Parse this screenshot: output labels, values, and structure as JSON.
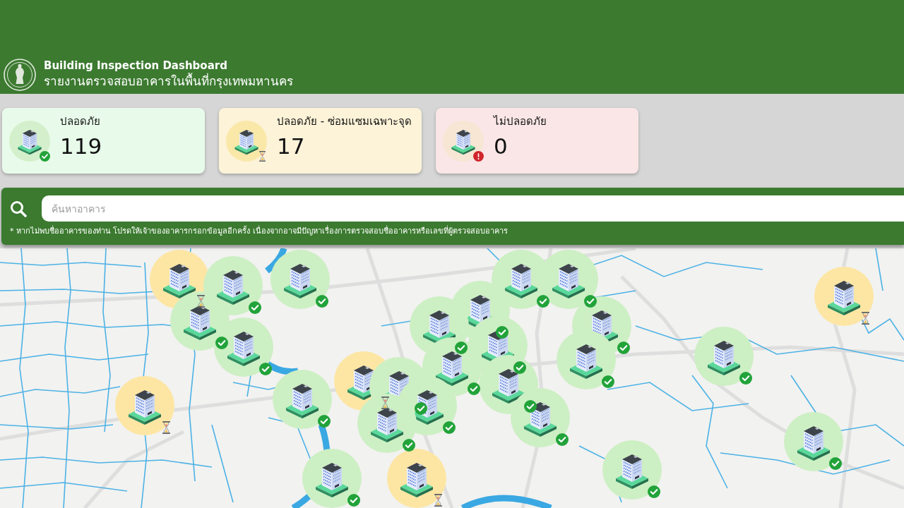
{
  "header": {
    "title": "Building Inspection Dashboard",
    "subtitle": "รายงานตรวจสอบอาคารในพื้นที่กรุงเทพมหานคร"
  },
  "summary_cards": [
    {
      "kind": "safe",
      "label": "ปลอดภัย",
      "count": "119"
    },
    {
      "kind": "repair",
      "label": "ปลอดภัย - ซ่อมแซมเฉพาะจุด",
      "count": "17"
    },
    {
      "kind": "unsafe",
      "label": "ไม่ปลอดภัย",
      "count": "0"
    }
  ],
  "search": {
    "placeholder": "ค้นหาอาคาร",
    "note": "* หากไม่พบชื่ออาคารของท่าน โปรดให้เจ้าของอาคารกรอกข้อมูลอีกครั้ง เนื่องจากอาจมีปัญหาเรื่องการตรวจสอบชื่ออาคารหรือเลขที่ผู้ตรวจสอบอาคาร"
  },
  "map": {
    "markers": [
      {
        "kind": "repair"
      },
      {
        "kind": "safe"
      },
      {
        "kind": "safe"
      },
      {
        "kind": "safe"
      },
      {
        "kind": "safe"
      },
      {
        "kind": "repair"
      },
      {
        "kind": "safe"
      },
      {
        "kind": "safe"
      },
      {
        "kind": "safe"
      },
      {
        "kind": "safe"
      },
      {
        "kind": "safe"
      },
      {
        "kind": "safe"
      },
      {
        "kind": "safe"
      },
      {
        "kind": "safe"
      },
      {
        "kind": "safe"
      },
      {
        "kind": "repair"
      },
      {
        "kind": "safe"
      },
      {
        "kind": "safe"
      },
      {
        "kind": "safe"
      },
      {
        "kind": "repair"
      },
      {
        "kind": "safe"
      },
      {
        "kind": "safe"
      },
      {
        "kind": "safe"
      },
      {
        "kind": "safe"
      },
      {
        "kind": "safe"
      },
      {
        "kind": "safe"
      },
      {
        "kind": "repair"
      }
    ]
  }
}
